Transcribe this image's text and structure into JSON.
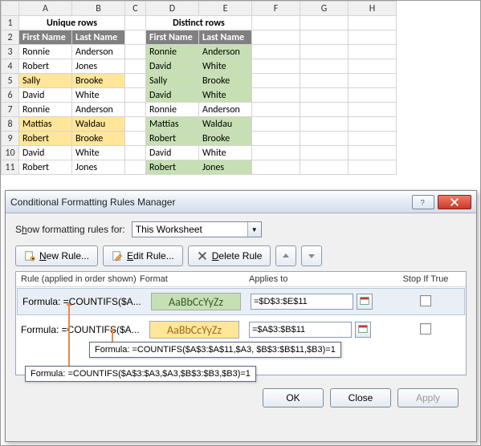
{
  "cols": [
    "A",
    "B",
    "C",
    "D",
    "E",
    "F",
    "G",
    "H"
  ],
  "titles": {
    "unique": "Unique rows",
    "distinct": "Distinct rows"
  },
  "headers": {
    "first": "First Name",
    "last": "Last Name"
  },
  "leftRows": [
    {
      "f": "Ronnie",
      "l": "Anderson",
      "hl": false
    },
    {
      "f": "Robert",
      "l": "Jones",
      "hl": false
    },
    {
      "f": "Sally",
      "l": "Brooke",
      "hl": true
    },
    {
      "f": "David",
      "l": "White",
      "hl": false
    },
    {
      "f": "Ronnie",
      "l": "Anderson",
      "hl": false
    },
    {
      "f": "Mattias",
      "l": "Waldau",
      "hl": true
    },
    {
      "f": "Robert",
      "l": "Brooke",
      "hl": true
    },
    {
      "f": "David",
      "l": "White",
      "hl": false
    },
    {
      "f": "Robert",
      "l": "Jones",
      "hl": false
    }
  ],
  "rightRows": [
    {
      "f": "Ronnie",
      "l": "Anderson",
      "hl": true
    },
    {
      "f": "David",
      "l": "White",
      "hl": true
    },
    {
      "f": "Sally",
      "l": "Brooke",
      "hl": true
    },
    {
      "f": "David",
      "l": "White",
      "hl": true
    },
    {
      "f": "Ronnie",
      "l": "Anderson",
      "hl": false
    },
    {
      "f": "Mattias",
      "l": "Waldau",
      "hl": true
    },
    {
      "f": "Robert",
      "l": "Brooke",
      "hl": true
    },
    {
      "f": "David",
      "l": "White",
      "hl": false
    },
    {
      "f": "Robert",
      "l": "Jones",
      "hl": true
    }
  ],
  "dialog": {
    "title": "Conditional Formatting Rules Manager",
    "showLabelPre": "S",
    "showLabelU": "h",
    "showLabelPost": "ow formatting rules for:",
    "scope": "This Worksheet",
    "newRuleU": "N",
    "newRule": "ew Rule...",
    "editRuleU": "E",
    "editRule": "dit Rule...",
    "deleteRuleU": "D",
    "deleteRule": "elete Rule",
    "hdrRule": "Rule (applied in order shown)",
    "hdrFormat": "Format",
    "hdrApplies": "Applies to",
    "hdrStop": "Stop If True",
    "previewText": "AaBbCcYyZz",
    "rules": [
      {
        "label": "Formula: =COUNTIFS($A...",
        "applies": "=$D$3:$E$11",
        "cls": "g",
        "selected": true
      },
      {
        "label": "Formula: =COUNTIFS($A...",
        "applies": "=$A$3:$B$11",
        "cls": "y",
        "selected": false
      }
    ],
    "ok": "OK",
    "close": "Close",
    "apply": "Apply"
  },
  "callouts": {
    "top": "Formula: =COUNTIFS($A$3:$A$11,$A3, $B$3:$B$11,$B3)=1",
    "bottom": "Formula: =COUNTIFS($A$3:$A3,$A3,$B$3:$B3,$B3)=1"
  }
}
